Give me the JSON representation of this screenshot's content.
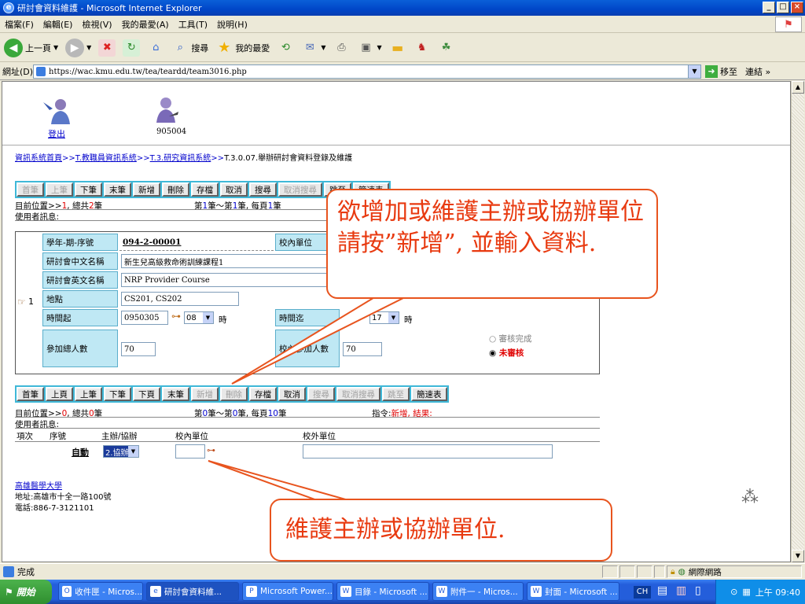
{
  "window": {
    "title": "研討會資料維護 - Microsoft Internet Explorer",
    "minimize": "_",
    "maximize": "□",
    "close": "×"
  },
  "menu": [
    "檔案(F)",
    "編輯(E)",
    "檢視(V)",
    "我的最愛(A)",
    "工具(T)",
    "說明(H)"
  ],
  "toolbar": {
    "back": "上一頁",
    "search": "搜尋",
    "favorites": "我的最愛"
  },
  "address": {
    "label": "網址(D)",
    "url": "https://wac.kmu.edu.tw/tea/teardd/team3016.php",
    "go": "移至",
    "links": "連結"
  },
  "page": {
    "logout": "登出",
    "user_id": "905004",
    "breadcrumb": {
      "home": "資訊系統首頁",
      "sep": ">>",
      "l1": "T.教職員資訊系統",
      "l2": "T.3.研究資訊系統",
      "current": "T.3.0.07.舉辦研討會資料登錄及維護"
    },
    "toolbar1": {
      "buttons": [
        "首筆",
        "上筆",
        "下筆",
        "末筆",
        "新增",
        "刪除",
        "存檔",
        "取消",
        "搜尋",
        "取消搜尋",
        "跳至",
        "簡速表"
      ],
      "enabled": [
        false,
        false,
        true,
        true,
        true,
        true,
        true,
        true,
        true,
        false,
        true,
        true
      ]
    },
    "status1": {
      "prefix": "目前位置>>",
      "pos": "1",
      "mid": ", 總共",
      "total": "2",
      "suffix": "筆",
      "page_info_a": "第",
      "pa": "1",
      "page_info_b": "筆～第",
      "pb": "1",
      "page_info_c": "筆, 每頁",
      "pc": "1",
      "page_info_d": "筆"
    },
    "usermsg_label": "使用者訊息:",
    "record": {
      "row_no": "1",
      "term_label": "學年-期-序號",
      "term_value": "094-2-00001",
      "unit_label": "校內單位",
      "cname_label": "研討會中文名稱",
      "cname_value": "新生兒高級救命術訓練課程1",
      "ename_label": "研討會英文名稱",
      "ename_value": "NRP Provider Course",
      "place_label": "地點",
      "place_value": "CS201, CS202",
      "start_label": "時間起",
      "start_date": "0950305",
      "start_hour": "08",
      "hour_unit": "時",
      "end_label": "時間迄",
      "end_hour": "17",
      "total_label": "參加總人數",
      "total_value": "70",
      "inside_label": "校內參加人數",
      "inside_value": "70",
      "review_done": "審核完成",
      "review_pending": "未審核"
    },
    "toolbar2": {
      "buttons": [
        "首筆",
        "上頁",
        "上筆",
        "下筆",
        "下頁",
        "末筆",
        "新增",
        "刪除",
        "存檔",
        "取消",
        "搜尋",
        "取消搜尋",
        "跳至",
        "簡速表"
      ],
      "enabled": [
        true,
        true,
        true,
        true,
        true,
        true,
        false,
        false,
        true,
        true,
        false,
        false,
        false,
        true
      ]
    },
    "status2": {
      "prefix": "目前位置>>",
      "pos": "0",
      "mid": ", 總共",
      "total": "0",
      "suffix": "筆",
      "page_info_a": "第",
      "pa": "0",
      "page_info_b": "筆～第",
      "pb": "0",
      "page_info_c": "筆, 每頁",
      "pc": "10",
      "page_info_d": "筆",
      "cmd_label": "指令:",
      "cmd_value": "新增, 結果:"
    },
    "sub": {
      "cols": [
        "項次",
        "序號",
        "主辦/協辦",
        "校內單位",
        "校外單位"
      ],
      "auto": "自動",
      "role_value": "2.協辦"
    },
    "footer": {
      "school": "高雄醫學大學",
      "address": "地址:高雄市十全一路100號",
      "phone": "電話:886-7-3121101"
    },
    "callout1": "欲增加或維護主辦或協辦單位請按”新增”, 並輸入資料.",
    "callout2": "維護主辦或協辦單位."
  },
  "statusbar": {
    "text": "完成",
    "zone": "網際網路"
  },
  "taskbar": {
    "start": "開始",
    "tasks": [
      "收件匣 - Micros...",
      "研討會資料維...",
      "Microsoft Power...",
      "目錄 - Microsoft ...",
      "附件一 - Micros...",
      "封面 - Microsoft ..."
    ],
    "ime": "CH",
    "clock": "上午 09:40"
  }
}
